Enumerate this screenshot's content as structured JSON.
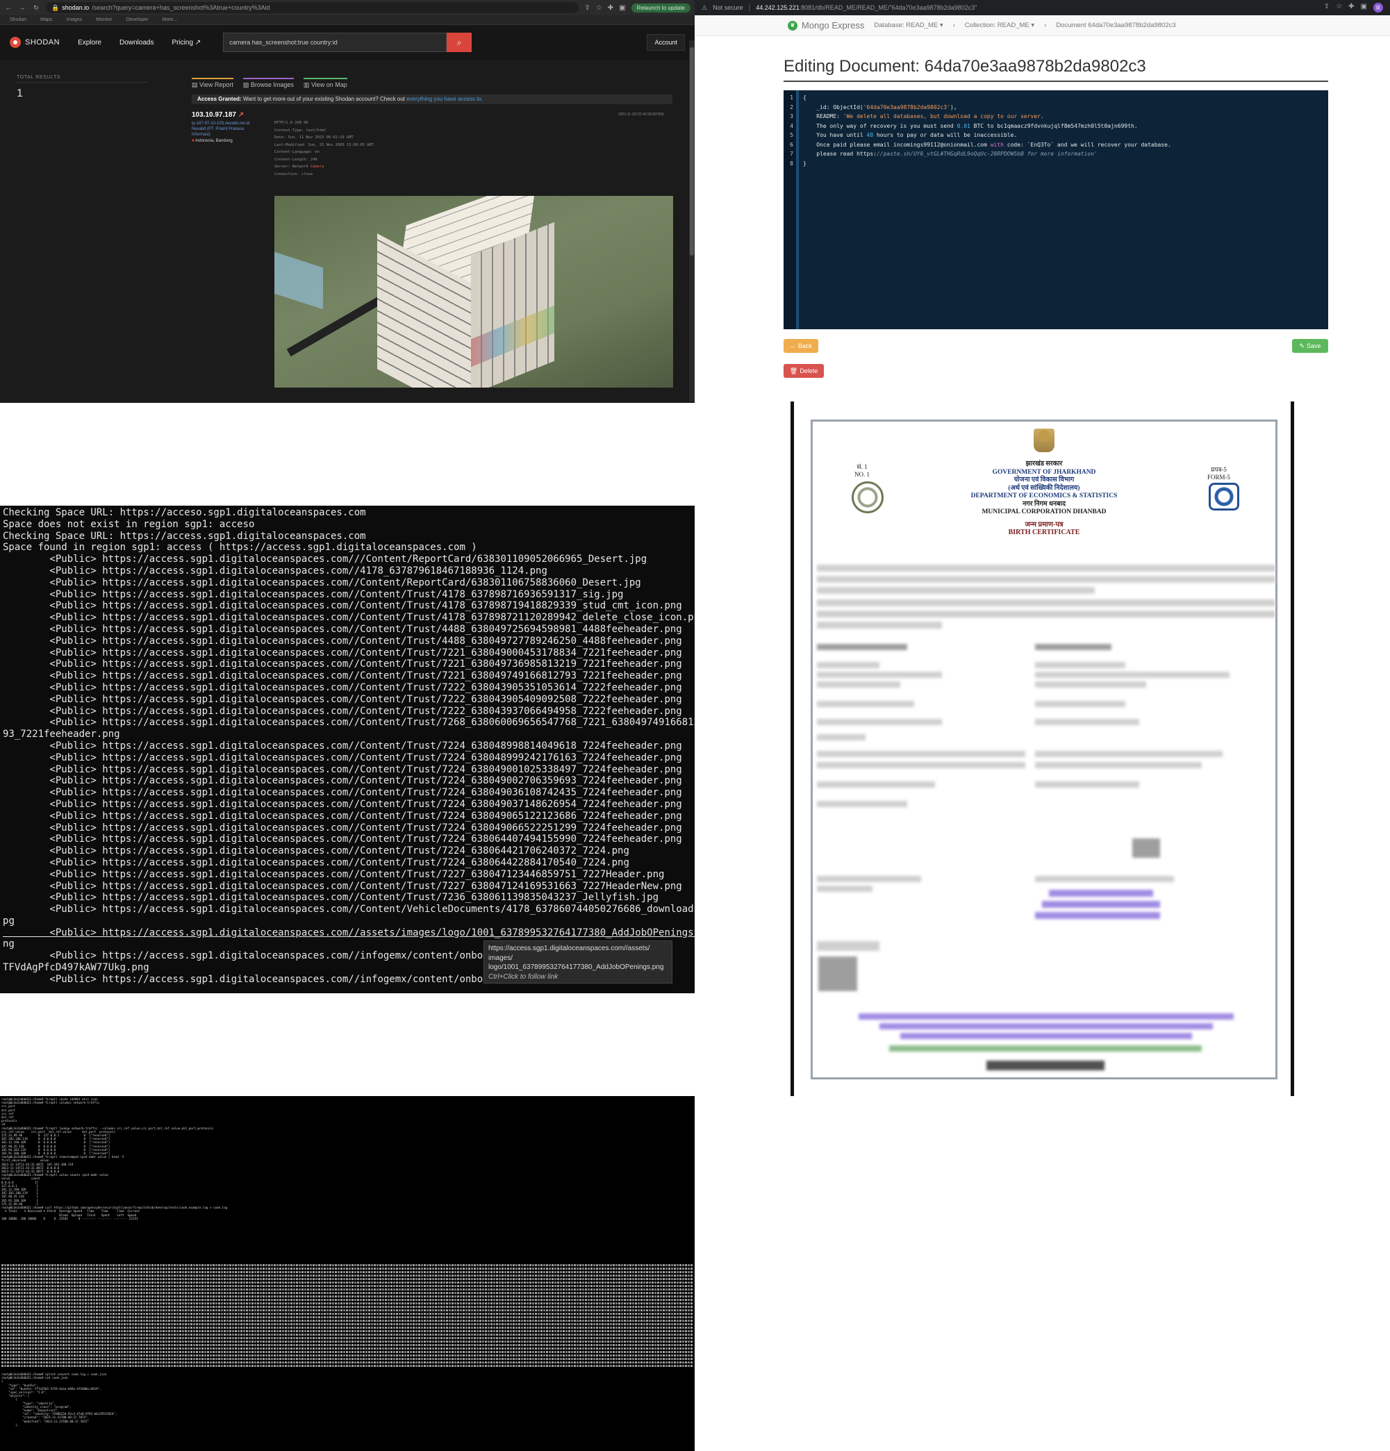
{
  "shodan": {
    "browser_url_host": "shodan.io",
    "browser_url_rest": "/search?query=camera+has_screenshot%3Atrue+country%3Aid",
    "relaunch_label": "Relaunch to update",
    "bookmarks": [
      "Shodan",
      "Maps",
      "Images",
      "Monitor",
      "Developer",
      "More..."
    ],
    "logo_text": "SHODAN",
    "nav": [
      "Explore",
      "Downloads",
      "Pricing ↗"
    ],
    "search_value": "camera has_screenshot:true country:id",
    "account_label": "Account",
    "total_results_label": "TOTAL RESULTS",
    "total_results_value": "1",
    "tabs": [
      "View Report",
      "Browse Images",
      "View on Map"
    ],
    "banner_strong": "Access Granted:",
    "banner_text": "Want to get more out of your existing Shodan account? Check out",
    "banner_link": "everything you have access to.",
    "result_ip": "103.10.97.187",
    "result_hostname": "ip-187-97-10-103.nexabit.net.id",
    "result_org": "Nexabit (PT. Prianti Prakasa Informasi)",
    "result_location": "Indonesia, Bandung",
    "result_date": "2023-11-16T22:42:28.007835",
    "http_lines": [
      "HTTP/1.0 200 OK",
      "Content-Type: text/html",
      "Date: Sun, 11 Nov 2023 06:42:19 GMT",
      "Last-Modified: Sun, 25 Nov 2009 15:00:05 GMT",
      "Content-Language: en",
      "Content-Length: 249",
      "Server: Network ",
      "Connection: close"
    ],
    "http_server_highlight": "Camera"
  },
  "mongo": {
    "not_secure": "Not secure",
    "url_host": "44.242.125.221",
    "url_rest": ":8081/db/READ_ME/READ_ME/\"64da70e3aa9878b2da9802c3\"",
    "brand": "Mongo Express",
    "crumb_db": "Database: READ_ME ▾",
    "crumb_coll": "Collection: READ_ME ▾",
    "crumb_doc": "Document 64da70e3aa9878b2da9802c3",
    "heading": "Editing Document: 64da70e3aa9878b2da9802c3",
    "line_numbers": [
      "1",
      "2",
      "3",
      "4",
      "5",
      "6",
      "7",
      "8"
    ],
    "code_open": "{",
    "code_id_key": "    _id: ObjectId(",
    "code_id_val": "'64da70e3aa9878b2da9802c3'",
    "code_id_end": "),",
    "code_readme_key": "    README: ",
    "code_readme_val": "'We delete all databases, but download a copy to our server.",
    "code_l4a": "    The only way of recovery is you must send ",
    "code_l4n": "0.01",
    "code_l4b": " BTC to bc1qmaacz9fdvnkujqlf8m547mzh0l5t0ajn699th.",
    "code_l5a": "    You have until ",
    "code_l5n": "48",
    "code_l5b": " hours to pay or data will be inaccessible.",
    "code_l6a": "    Once paid please email incomings99112@onionmail.com ",
    "code_l6k": "with",
    "code_l6b": " code: `EnQ3To` and we will recover your database.",
    "code_l7a": "    please read https:",
    "code_l7c": "//paste.sh/UY6_vtGL#THGqRdL9oQqUc-28RPDOW5bB for more information'",
    "code_close": "}",
    "back_label": "Back",
    "save_label": "Save",
    "delete_label": "Delete"
  },
  "terminal": {
    "lines": [
      "Checking Space URL: https://acceso.sgp1.digitaloceanspaces.com",
      "Space does not exist in region sgp1: acceso",
      "Checking Space URL: https://access.sgp1.digitaloceanspaces.com",
      "Space found in region sgp1: access ( https://access.sgp1.digitaloceanspaces.com )",
      "        <Public> https://access.sgp1.digitaloceanspaces.com///Content/ReportCard/638301109052066965_Desert.jpg",
      "        <Public> https://access.sgp1.digitaloceanspaces.com//4178_637879618467188936_1124.png",
      "        <Public> https://access.sgp1.digitaloceanspaces.com//Content/ReportCard/638301106758836060_Desert.jpg",
      "        <Public> https://access.sgp1.digitaloceanspaces.com//Content/Trust/4178_637898716936591317_sig.jpg",
      "        <Public> https://access.sgp1.digitaloceanspaces.com//Content/Trust/4178_637898719418829339_stud_cmt_icon.png",
      "        <Public> https://access.sgp1.digitaloceanspaces.com//Content/Trust/4178_637898721120289942_delete_close_icon.png",
      "        <Public> https://access.sgp1.digitaloceanspaces.com//Content/Trust/4488_638049725694598981_4488feeheader.png",
      "        <Public> https://access.sgp1.digitaloceanspaces.com//Content/Trust/4488_638049727789246250_4488feeheader.png",
      "        <Public> https://access.sgp1.digitaloceanspaces.com//Content/Trust/7221_638049000453178834_7221feeheader.png",
      "        <Public> https://access.sgp1.digitaloceanspaces.com//Content/Trust/7221_638049736985813219_7221feeheader.png",
      "        <Public> https://access.sgp1.digitaloceanspaces.com//Content/Trust/7221_638049749166812793_7221feeheader.png",
      "        <Public> https://access.sgp1.digitaloceanspaces.com//Content/Trust/7222_638043905351053614_7222feeheader.png",
      "        <Public> https://access.sgp1.digitaloceanspaces.com//Content/Trust/7222_638043905409092508_7222feeheader.png",
      "        <Public> https://access.sgp1.digitaloceanspaces.com//Content/Trust/7222_638043937066494958_7222feeheader.png",
      "        <Public> https://access.sgp1.digitaloceanspaces.com//Content/Trust/7268_638060069656547768_7221_638049749166812127",
      "93_7221feeheader.png",
      "        <Public> https://access.sgp1.digitaloceanspaces.com//Content/Trust/7224_638048998814049618_7224feeheader.png",
      "        <Public> https://access.sgp1.digitaloceanspaces.com//Content/Trust/7224_638048999242176163_7224feeheader.png",
      "        <Public> https://access.sgp1.digitaloceanspaces.com//Content/Trust/7224_638049001025338497_7224feeheader.png",
      "        <Public> https://access.sgp1.digitaloceanspaces.com//Content/Trust/7224_638049002706359693_7224feeheader.png",
      "        <Public> https://access.sgp1.digitaloceanspaces.com//Content/Trust/7224_638049036108742435_7224feeheader.png",
      "        <Public> https://access.sgp1.digitaloceanspaces.com//Content/Trust/7224_638049037148626954_7224feeheader.png",
      "        <Public> https://access.sgp1.digitaloceanspaces.com//Content/Trust/7224_638049065122123686_7224feeheader.png",
      "        <Public> https://access.sgp1.digitaloceanspaces.com//Content/Trust/7224_638049066522251299_7224feeheader.png",
      "        <Public> https://access.sgp1.digitaloceanspaces.com//Content/Trust/7224_638064407494155990_7224feeheader.png",
      "        <Public> https://access.sgp1.digitaloceanspaces.com//Content/Trust/7224_638064421706240372_7224.png",
      "        <Public> https://access.sgp1.digitaloceanspaces.com//Content/Trust/7224_638064422884170540_7224.png",
      "        <Public> https://access.sgp1.digitaloceanspaces.com//Content/Trust/7227_638047123446859751_7227Header.png",
      "        <Public> https://access.sgp1.digitaloceanspaces.com//Content/Trust/7227_638047124169531663_7227HeaderNew.png",
      "        <Public> https://access.sgp1.digitaloceanspaces.com//Content/Trust/7236_638061139835043237_Jellyfish.jpg",
      "        <Public> https://access.sgp1.digitaloceanspaces.com//Content/VehicleDocuments/4178_637860744050276686_download.j",
      "pg",
      "        <Public> https://access.sgp1.digitaloceanspaces.com//assets/images/logo/1001_637899532764177380_AddJobOPenings.p",
      "ng",
      "        <Public> https://access.sgp1.digitaloceanspaces.com//infogemx/content/onboard",
      "TFVdAgPfcD497kAW77Ukg.png",
      "        <Public> https://access.sgp1.digitaloceanspaces.com//infogemx/content/onboard"
    ],
    "tooltip_url1": "https://access.sgp1.digitaloceanspaces.com//assets/",
    "tooltip_url2": "images/",
    "tooltip_url3": "logo/1001_637899532764177380_AddJobOPenings.png",
    "tooltip_hint": "Ctrl+Click to follow link"
  },
  "certificate": {
    "left_no_hi": "सं. 1",
    "left_no": "NO. 1",
    "right_form_hi": "प्रपत्र-5",
    "right_form": "FORM-5",
    "state_hi": "झारखंड सरकार",
    "state": "GOVERNMENT OF JHARKHAND",
    "dept_hi": "योजना एवं विकास विभाग",
    "dept_hi2": "(अर्थ एवं सांख्यिकी निदेशालय)",
    "dept": "DEPARTMENT OF ECONOMICS & STATISTICS",
    "corp_hi": "नगर निगम धनबाद",
    "corp": "MUNICIPAL CORPORATION DHANBAD",
    "title_hi": "जन्म प्रमाण-पत्र",
    "title": "BIRTH CERTIFICATE"
  },
  "small_terminal": {
    "lines": [
      "root@0c3e2a4b0d21:/home# fireptl cache id4901 etis json",
      "root@0c3e2a4b0d21:/home# fireptl columns network-traffic",
      "src_port",
      "dst_port",
      "src_ref",
      "dst_ref",
      "protocols",
      "id",
      "root@0c3e2a4b0d21:/home# fireptl lookup network-traffic --columns src_ref.value,src_port,dst_ref.value,dst_port,protocols",
      "src_ref.value    src_port  dst_ref.value      dst_port  protocols",
      "",
      "175.31.99.96         0  127.0.0.1              0  [\"reserved\"]",
      "107.183.100.119      0  0.0.0.0                0  [\"reserved\"]",
      "101.12.190.109       0  0.0.0.0                0  [\"reserved\"]",
      "107.90.35.138        0  0.0.0.0                0  [\"reserved\"]",
      "165.94.183.119       0  0.0.0.0                0  [\"reserved\"]",
      "165.91.100.109       0  0.0.0.0                0  [\"reserved\"]",
      "root@0c3e2a4b0d21:/home# fireptl timestamped ipv4-addr value | head -5",
      "first_observed        value",
      "",
      "2023-11-14T11:43:31.087Z  107.183.100.119",
      "2023-11-14T11:43:31.087Z  0.0.0.0",
      "2023-11-14T11:43:31.087Z  0.0.0.0",
      "root@0c3e2a4b0d21:/home# fireptl value-counts ipv4-addr value",
      "value            count",
      "",
      "0.0.0.0            17",
      "127.0.0.1           1",
      "101.12.190.109      1",
      "107.183.100.119     1",
      "107.90.35.138       1",
      "165.91.100.109      1",
      "175.31.99.96        1",
      "root@0c3e2a4b0d21:/home# curl https://github.com/opencybersecurityalliance/firepit/blob/develop/tests/cook_example.log > cook.log",
      "  % Total    % Received % Xferd  Average Speed   Time    Time     Time  Current",
      "                                 Dload  Upload   Total   Spent    Left  Speed",
      "100 10006  100 10006    0     0  22101      0 --:--:-- --:--:-- --:--:-- 22151"
    ],
    "tail_lines": [
      "root@0c3e2a4b0d21:/home# splint convert cook.log > cook.json",
      "root@0c3e2a4b0d21:/home# cat cook.json",
      "{",
      "    \"type\": \"bundle\",",
      "    \"id\": \"bundle--f7fa25b5-5f19-4cba-b09a-4f5d80cc4619\",",
      "    \"spec_version\": \"2.0\",",
      "    \"objects\": [",
      "        {",
      "            \"type\": \"identity\",",
      "            \"identity_class\": \"program\",",
      "            \"name\": \"basestruct\",",
      "            \"id\": \"identity--f290623d-92c3-47e0-9793-b6c5953f016\",",
      "            \"created\": \"2023-11-21T08:40:37.707Z\",",
      "            \"modified\": \"2023-11-21T08:40:37.707Z\"",
      "        },"
    ]
  }
}
